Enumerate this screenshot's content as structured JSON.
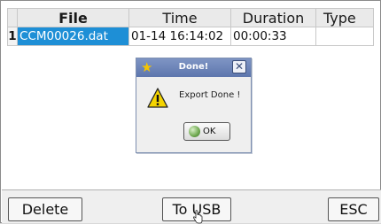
{
  "table": {
    "headers": [
      "",
      "File",
      "Time",
      "Duration",
      "Type"
    ],
    "rows": [
      {
        "num": "1",
        "file": "CCM00026.dat",
        "time": "01-14 16:14:02",
        "duration": "00:00:33",
        "type": ""
      }
    ]
  },
  "dialog": {
    "title": "Done!",
    "message": "Export Done !",
    "ok_label": "OK",
    "close_glyph": "✕",
    "icons": {
      "title": "star-icon",
      "body": "warning-icon",
      "button": "ok-ball-icon"
    }
  },
  "buttons": {
    "delete": "Delete",
    "to_usb": "To USB",
    "esc": "ESC"
  },
  "colors": {
    "selected_row": "#1e8fd6",
    "titlebar": "#6b82b8",
    "warning": "#f5d400"
  }
}
